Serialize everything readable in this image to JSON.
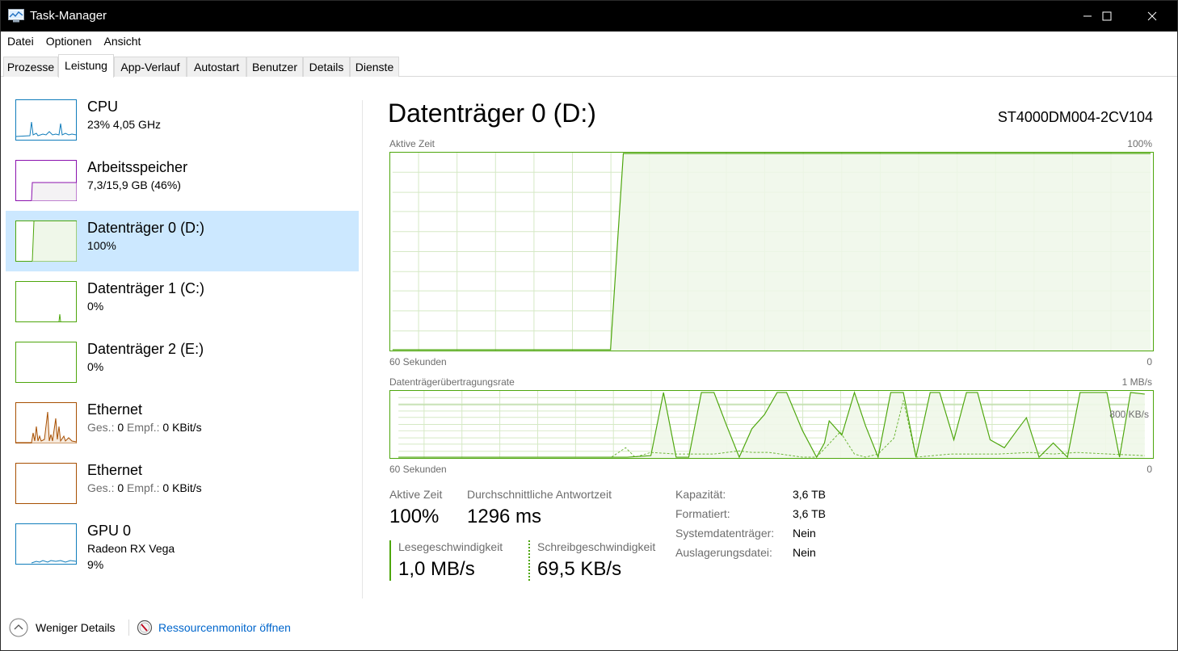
{
  "window": {
    "title": "Task-Manager",
    "controls": {
      "minimize": "minimize",
      "maximize": "maximize",
      "close": "close"
    }
  },
  "menu": [
    {
      "label": "Datei"
    },
    {
      "label": "Optionen"
    },
    {
      "label": "Ansicht"
    }
  ],
  "tabs": [
    {
      "label": "Prozesse",
      "active": false
    },
    {
      "label": "Leistung",
      "active": true
    },
    {
      "label": "App-Verlauf",
      "active": false
    },
    {
      "label": "Autostart",
      "active": false
    },
    {
      "label": "Benutzer",
      "active": false
    },
    {
      "label": "Details",
      "active": false
    },
    {
      "label": "Dienste",
      "active": false
    }
  ],
  "sidebar": {
    "items": [
      {
        "name": "CPU",
        "sub": "23%  4,05 GHz",
        "color": "#117dbb",
        "selected": false
      },
      {
        "name": "Arbeitsspeicher",
        "sub": "7,3/15,9 GB (46%)",
        "color": "#8b12ae",
        "selected": false
      },
      {
        "name": "Datenträger 0 (D:)",
        "sub": "100%",
        "color": "#4da60c",
        "selected": true
      },
      {
        "name": "Datenträger 1 (C:)",
        "sub": "0%",
        "color": "#4da60c",
        "selected": false
      },
      {
        "name": "Datenträger 2 (E:)",
        "sub": "0%",
        "color": "#4da60c",
        "selected": false
      },
      {
        "name": "Ethernet",
        "sub_parts": {
          "send_label": "Ges.:",
          "send_value": "0",
          "recv_label": "Empf.:",
          "recv_value": "0 KBit/s"
        },
        "color": "#a74f01",
        "selected": false
      },
      {
        "name": "Ethernet",
        "sub_parts": {
          "send_label": "Ges.:",
          "send_value": "0",
          "recv_label": "Empf.:",
          "recv_value": "0 KBit/s"
        },
        "color": "#a74f01",
        "selected": false
      },
      {
        "name": "GPU 0",
        "sub": "Radeon RX Vega",
        "sub2": "9%",
        "color": "#117dbb",
        "selected": false
      }
    ]
  },
  "main": {
    "title": "Datenträger 0 (D:)",
    "model": "ST4000DM004-2CV104",
    "active_graph": {
      "label": "Aktive Zeit",
      "max_label": "100%",
      "time_label": "60 Sekunden",
      "min_label": "0"
    },
    "transfer_graph": {
      "label": "Datenträgerübertragungsrate",
      "max_label": "1 MB/s",
      "mid_label": "800 KB/s",
      "time_label": "60 Sekunden",
      "min_label": "0"
    },
    "stats": {
      "active_time_label": "Aktive Zeit",
      "active_time_value": "100%",
      "response_label": "Durchschnittliche Antwortzeit",
      "response_value": "1296 ms",
      "read_label": "Lesegeschwindigkeit",
      "read_value": "1,0 MB/s",
      "write_label": "Schreibgeschwindigkeit",
      "write_value": "69,5 KB/s"
    },
    "properties": [
      {
        "label": "Kapazität:",
        "value": "3,6 TB"
      },
      {
        "label": "Formatiert:",
        "value": "3,6 TB"
      },
      {
        "label": "Systemdatenträger:",
        "value": "Nein"
      },
      {
        "label": "Auslagerungsdatei:",
        "value": "Nein"
      }
    ]
  },
  "footer": {
    "fewer_details": "Weniger Details",
    "resource_monitor": "Ressourcenmonitor öffnen"
  },
  "colors": {
    "disk": "#4da60c",
    "disk_fill": "#eff7e9",
    "grid": "#d5e9c5",
    "selected": "#cce8ff",
    "link": "#0066cc"
  }
}
